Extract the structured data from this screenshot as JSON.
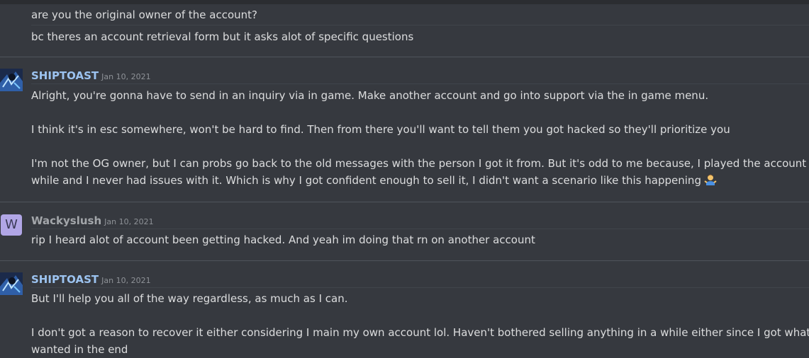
{
  "messages": {
    "continuation": {
      "lines": [
        "are you the original owner of the account?",
        "bc theres an account retrieval form but it asks alot of specific questions"
      ]
    },
    "msg1": {
      "author": "SHIPTOAST",
      "date": "Jan 10, 2021",
      "lines": [
        "Alright, you're gonna have to send in an inquiry via in game. Make another account and go into support via the in game menu.",
        "I think it's in esc somewhere, won't be hard to find. Then from there you'll want to tell them you got hacked so they'll prioritize you",
        "I'm not the OG owner, but I can probs go back to the old messages with the person I got it from. But it's odd to me because, I played the account for a",
        "while and I never had issues with it. Which is why I got confident enough to sell it, I didn't want a scenario like this happening"
      ],
      "emoji": "person-shrugging-emoji"
    },
    "msg2": {
      "author": "Wackyslush",
      "avatar_letter": "W",
      "date": "Jan 10, 2021",
      "lines": [
        "rip I heard alot of account been getting hacked. And yeah im doing that rn on another account"
      ]
    },
    "msg3": {
      "author": "SHIPTOAST",
      "date": "Jan 10, 2021",
      "lines": [
        "But I'll help you all of the way regardless, as much as I can.",
        "I don't got a reason to recover it either considering I main my own account lol. Haven't bothered selling anything in a while either since I got what I",
        "wanted in the end"
      ]
    }
  },
  "colors": {
    "background": "#36393f",
    "text": "#dcddde",
    "shiptoast_name": "#9cc3f0",
    "wackyslush_name": "#a3a6aa",
    "timestamp": "#8e9297",
    "divider": "#4f545c"
  }
}
